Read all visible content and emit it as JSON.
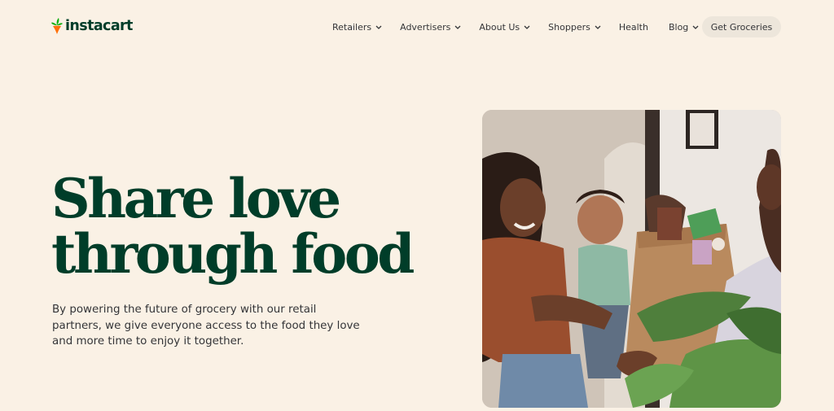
{
  "header": {
    "logo_text": "instacart",
    "nav": [
      {
        "label": "Retailers",
        "has_dropdown": true
      },
      {
        "label": "Advertisers",
        "has_dropdown": true
      },
      {
        "label": "About Us",
        "has_dropdown": true
      },
      {
        "label": "Shoppers",
        "has_dropdown": true
      },
      {
        "label": "Health",
        "has_dropdown": false
      },
      {
        "label": "Blog",
        "has_dropdown": true
      }
    ],
    "cta_label": "Get Groceries"
  },
  "hero": {
    "title_line1": "Share love",
    "title_line2": "through food",
    "description": "By powering the future of grocery with our retail partners, we give everyone access to the food they love and more time to enjoy it together."
  },
  "photo": {
    "icon": "family-groceries-photo"
  },
  "colors": {
    "background": "#FAF1E5",
    "brand_green": "#003D29",
    "carrot_orange": "#FF7009",
    "leaf_green": "#0AAD0A",
    "cta_background": "#EDE6DB"
  }
}
